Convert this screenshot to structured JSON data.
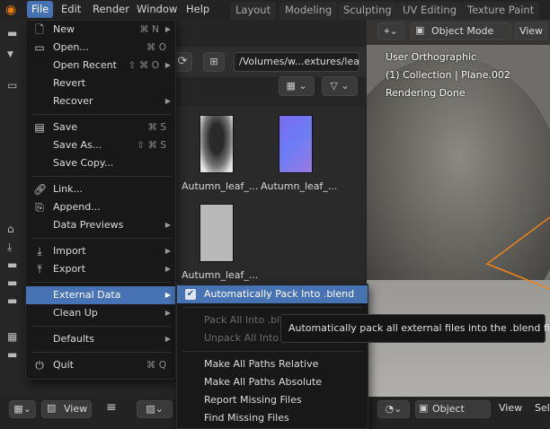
{
  "topbar": {
    "menus": [
      "File",
      "Edit",
      "Render",
      "Window",
      "Help"
    ],
    "workspace_tabs": [
      "Layout",
      "Modeling",
      "Sculpting",
      "UV Editing",
      "Texture Paint"
    ]
  },
  "file_browser": {
    "path": "/Volumes/w...extures/leaf/",
    "thumbnails": [
      {
        "label": "Autumn_leaf_..."
      },
      {
        "label": "Autumn_leaf_..."
      },
      {
        "label": "Autumn_leaf_..."
      }
    ]
  },
  "file_menu": {
    "items": [
      {
        "label": "New",
        "shortcut": "⌘ N",
        "icon": "new-file-icon",
        "submenu": true
      },
      {
        "label": "Open...",
        "shortcut": "⌘ O",
        "icon": "folder-open-icon"
      },
      {
        "label": "Open Recent",
        "shortcut": "⇧ ⌘ O",
        "submenu": true
      },
      {
        "label": "Revert"
      },
      {
        "label": "Recover",
        "submenu": true
      },
      {
        "label": "Save",
        "shortcut": "⌘ S",
        "icon": "save-icon"
      },
      {
        "label": "Save As...",
        "shortcut": "⇧ ⌘ S"
      },
      {
        "label": "Save Copy..."
      },
      {
        "label": "Link...",
        "icon": "link-icon"
      },
      {
        "label": "Append...",
        "icon": "append-icon"
      },
      {
        "label": "Data Previews",
        "submenu": true
      },
      {
        "label": "Import",
        "icon": "import-icon",
        "submenu": true
      },
      {
        "label": "Export",
        "icon": "export-icon",
        "submenu": true
      },
      {
        "label": "External Data",
        "submenu": true
      },
      {
        "label": "Clean Up",
        "submenu": true
      },
      {
        "label": "Defaults",
        "submenu": true
      },
      {
        "label": "Quit",
        "shortcut": "⌘ Q",
        "icon": "power-icon"
      }
    ]
  },
  "external_data_menu": {
    "items": [
      {
        "label": "Automatically Pack Into .blend",
        "checked": true
      },
      {
        "label": "Pack All Into .blend",
        "enabled": false
      },
      {
        "label": "Unpack All Into Files",
        "enabled": false
      },
      {
        "label": "Make All Paths Relative"
      },
      {
        "label": "Make All Paths Absolute"
      },
      {
        "label": "Report Missing Files"
      },
      {
        "label": "Find Missing Files"
      }
    ]
  },
  "tooltip": {
    "text": "Automatically pack all external files into the .blend file."
  },
  "viewport": {
    "mode": "Object Mode",
    "view_label": "View",
    "info_lines": [
      "User Orthographic",
      "(1) Collection | Plane.002",
      "Rendering Done"
    ]
  },
  "bottom_bar": {
    "view_label": "View",
    "object_label": "Object",
    "view_label_2": "View",
    "select_label": "Sele"
  },
  "colors": {
    "accent": "#4772b3",
    "menu_bg": "#181818",
    "app_bg": "#1d1d1d"
  }
}
